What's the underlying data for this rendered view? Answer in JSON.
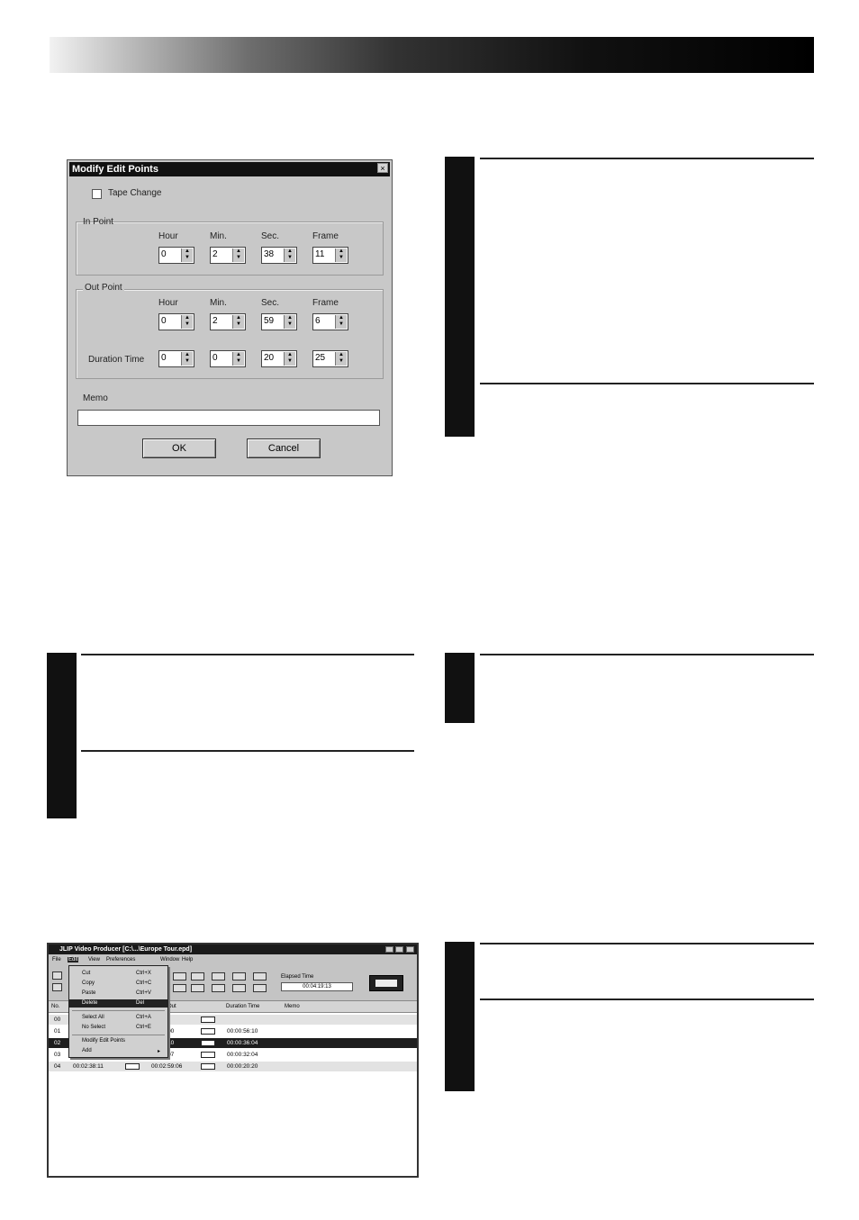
{
  "dialog": {
    "title": "Modify Edit Points",
    "close_glyph": "×",
    "tape_change_label": "Tape Change",
    "in_point": {
      "label": "In Point",
      "col_labels": [
        "Hour",
        "Min.",
        "Sec.",
        "Frame"
      ],
      "values": [
        "0",
        "2",
        "38",
        "11"
      ]
    },
    "out_point": {
      "label": "Out Point",
      "col_labels": [
        "Hour",
        "Min.",
        "Sec.",
        "Frame"
      ],
      "values": [
        "0",
        "2",
        "59",
        "6"
      ]
    },
    "duration": {
      "label": "Duration Time",
      "values": [
        "0",
        "0",
        "20",
        "25"
      ]
    },
    "memo_label": "Memo",
    "memo_value": "",
    "ok_label": "OK",
    "cancel_label": "Cancel"
  },
  "app": {
    "title": "JLIP Video Producer [C:\\...\\Europe Tour.epd]",
    "menus": [
      "File",
      "Edit",
      "View",
      "Preferences",
      "Window",
      "Help"
    ],
    "edit_menu": [
      {
        "label": "Cut",
        "shortcut": "Ctrl+X"
      },
      {
        "label": "Copy",
        "shortcut": "Ctrl+C"
      },
      {
        "label": "Paste",
        "shortcut": "Ctrl+V"
      },
      {
        "label": "Delete",
        "shortcut": "Del"
      },
      {
        "label": "Select All",
        "shortcut": "Ctrl+A"
      },
      {
        "label": "No Select",
        "shortcut": "Ctrl+E"
      },
      {
        "label": "Modify Edit Points",
        "shortcut": ""
      },
      {
        "label": "Add",
        "shortcut": "▸"
      }
    ],
    "elapsed_label": "Elapsed Time",
    "elapsed_value": "00:04:19:13",
    "columns": [
      "No.",
      "Out",
      "Duration Time",
      "Memo"
    ],
    "rows": [
      {
        "no": "00",
        "in": "",
        "out": "",
        "duration": "",
        "memo": ""
      },
      {
        "no": "01",
        "in": "",
        "out": "01:10:00",
        "duration": "00:00:56:10",
        "memo": ""
      },
      {
        "no": "02",
        "in": "",
        "out": "01:50:10",
        "duration": "00:00:36:04",
        "memo": ""
      },
      {
        "no": "03",
        "in": "",
        "out": "02:30:07",
        "duration": "00:00:32:04",
        "memo": ""
      },
      {
        "no": "04",
        "in": "00:02:38:11",
        "out": "00:02:59:06",
        "duration": "00:00:20:20",
        "memo": ""
      }
    ]
  }
}
